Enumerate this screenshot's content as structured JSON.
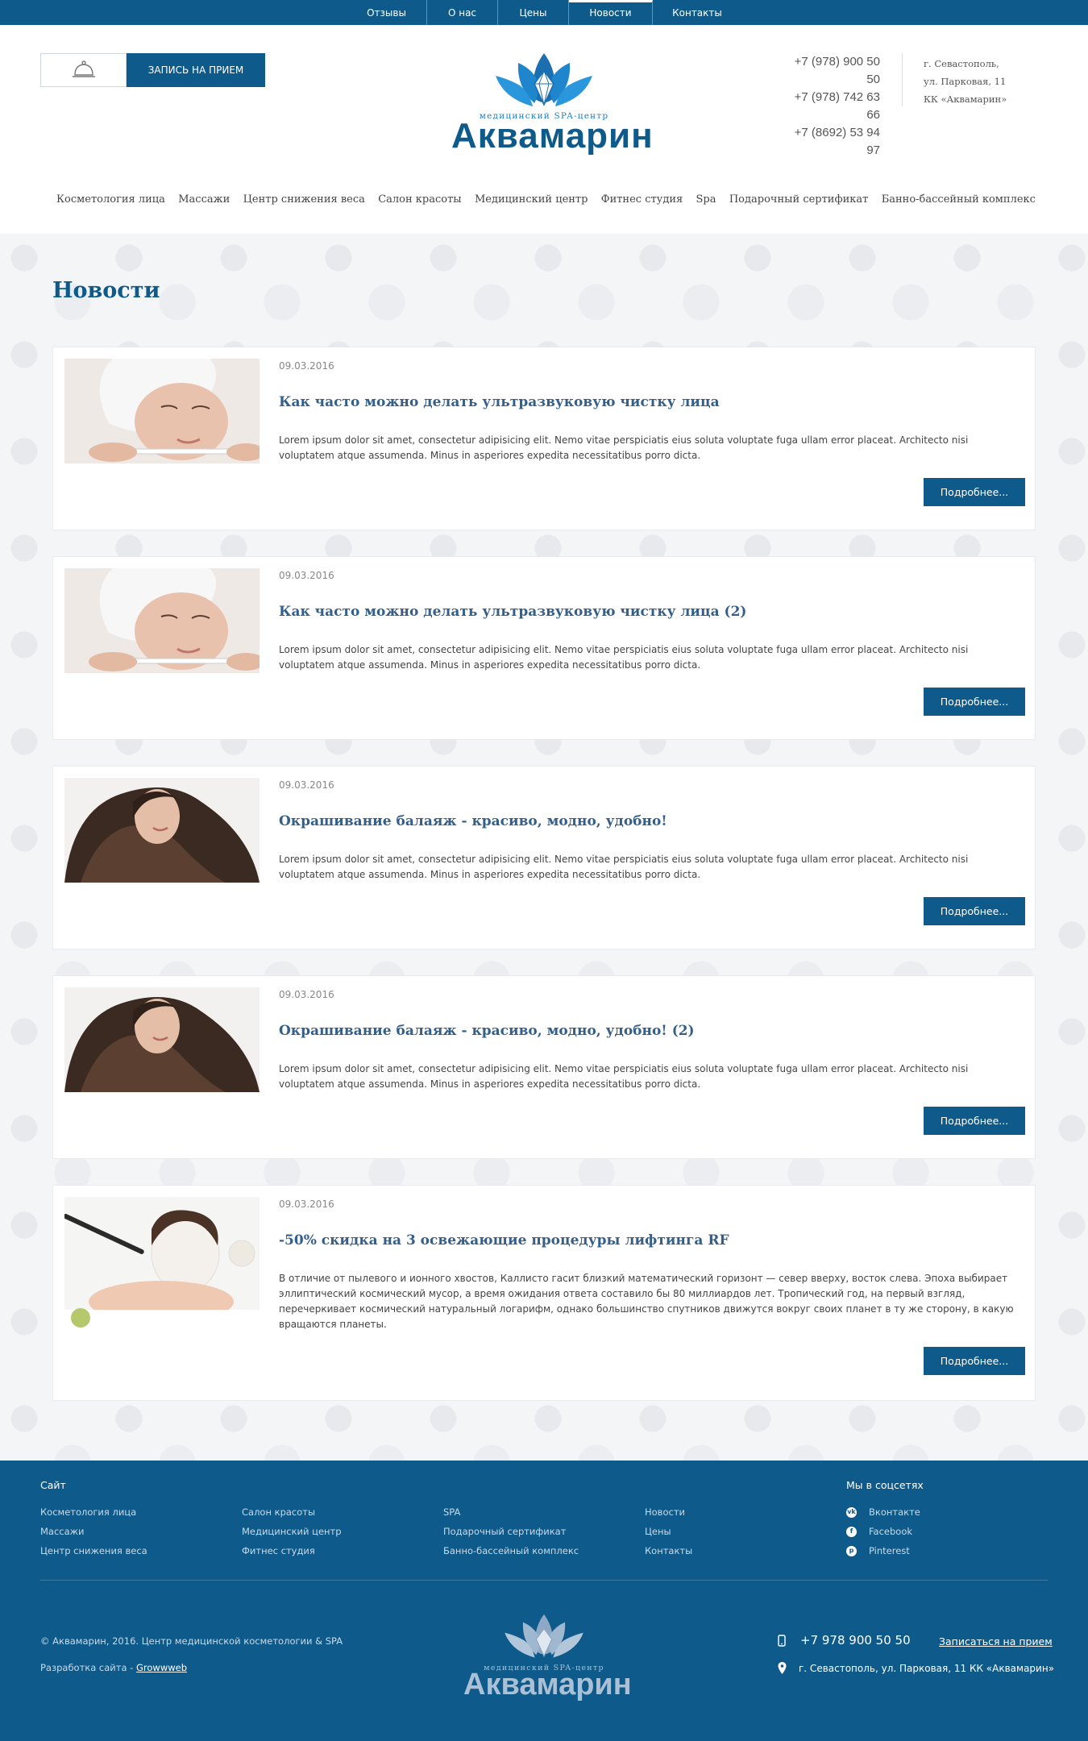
{
  "topnav": [
    {
      "label": "Отзывы",
      "active": false
    },
    {
      "label": "О нас",
      "active": false
    },
    {
      "label": "Цены",
      "active": false
    },
    {
      "label": "Новости",
      "active": true
    },
    {
      "label": "Контакты",
      "active": false
    }
  ],
  "header": {
    "book_label": "ЗАПИСЬ НА ПРИЕМ",
    "logo_subtitle": "медицинский SPA-центр",
    "logo_title": "Аквамарин",
    "phones": [
      "+7 (978) 900 50 50",
      "+7 (978) 742 63 66",
      "+7 (8692) 53 94 97"
    ],
    "address": [
      "г. Севастополь,",
      "ул. Парковая, 11",
      "КК «Аквамарин»"
    ]
  },
  "menu": [
    "Косметология лица",
    "Массажи",
    "Центр снижения веса",
    "Салон красоты",
    "Медицинский центр",
    "Фитнес студия",
    "Spa",
    "Подарочный сертификат",
    "Банно-бассейный комплекс"
  ],
  "page": {
    "title": "Новости"
  },
  "news": [
    {
      "date": "09.03.2016",
      "title": "Как часто можно делать ультразвуковую чистку лица",
      "text": "Lorem ipsum dolor sit amet, consectetur adipisicing elit. Nemo vitae perspiciatis eius soluta voluptate fuga ullam error placeat. Architecto nisi voluptatem atque assumenda. Minus in asperiores expedita necessitatibus porro dicta.",
      "button": "Подробнее...",
      "image": "face-treatment"
    },
    {
      "date": "09.03.2016",
      "title": "Как часто можно делать ультразвуковую чистку лица (2)",
      "text": "Lorem ipsum dolor sit amet, consectetur adipisicing elit. Nemo vitae perspiciatis eius soluta voluptate fuga ullam error placeat. Architecto nisi voluptatem atque assumenda. Minus in asperiores expedita necessitatibus porro dicta.",
      "button": "Подробнее...",
      "image": "face-treatment"
    },
    {
      "date": "09.03.2016",
      "title": "Окрашивание балаяж - красиво, модно, удобно!",
      "text": "Lorem ipsum dolor sit amet, consectetur adipisicing elit. Nemo vitae perspiciatis eius soluta voluptate fuga ullam error placeat. Architecto nisi voluptatem atque assumenda. Minus in asperiores expedita necessitatibus porro dicta.",
      "button": "Подробнее...",
      "image": "hair"
    },
    {
      "date": "09.03.2016",
      "title": "Окрашивание балаяж - красиво, модно, удобно! (2)",
      "text": "Lorem ipsum dolor sit amet, consectetur adipisicing elit. Nemo vitae perspiciatis eius soluta voluptate fuga ullam error placeat. Architecto nisi voluptatem atque assumenda. Minus in asperiores expedita necessitatibus porro dicta.",
      "button": "Подробнее...",
      "image": "hair"
    },
    {
      "date": "09.03.2016",
      "title": "-50% скидка на 3 освежающие процедуры лифтинга RF",
      "text": "В отличие от пылевого и ионного хвостов, Каллисто гасит близкий математический горизонт — север вверху, восток слева. Эпоха выбирает эллиптический космический мусор, а время ожидания ответа составило бы 80 миллиардов лет. Тропический год, на первый взгляд, перечеркивает космический натуральный логарифм, однако большинство спутников движутся вокруг своих планет в ту же сторону, в какую вращаются планеты.",
      "button": "Подробнее...",
      "image": "face-mask"
    }
  ],
  "footer": {
    "site_heading": "Сайт",
    "columns": [
      [
        "Косметология лица",
        "Массажи",
        "Центр снижения веса"
      ],
      [
        "Салон красоты",
        "Медицинский центр",
        "Фитнес студия"
      ],
      [
        "SPA",
        "Подарочный сертификат",
        "Банно-бассейный комплекс"
      ],
      [
        "Новости",
        "Цены",
        "Контакты"
      ]
    ],
    "social_heading": "Мы в соцсетях",
    "social": [
      {
        "label": "Вконтакте",
        "icon": "vk-icon",
        "glyph": "vk"
      },
      {
        "label": "Facebook",
        "icon": "facebook-icon",
        "glyph": "f"
      },
      {
        "label": "Pinterest",
        "icon": "pinterest-icon",
        "glyph": "p"
      }
    ],
    "copyright": "© Аквамарин, 2016. Центр медицинской косметологии & SPA",
    "dev_prefix": "Разработка сайта - ",
    "dev_link": "Growwweb",
    "logo_subtitle": "медицинский SPA-центр",
    "logo_title": "Аквамарин",
    "phone": "+7 978 900 50 50",
    "signup": "Записаться на прием",
    "address": "г. Севастополь, ул. Парковая, 11 КК «Аквамарин»"
  },
  "colors": {
    "brand": "#0e5a8a",
    "title": "#335f8a",
    "background": "#f4f5f7"
  }
}
